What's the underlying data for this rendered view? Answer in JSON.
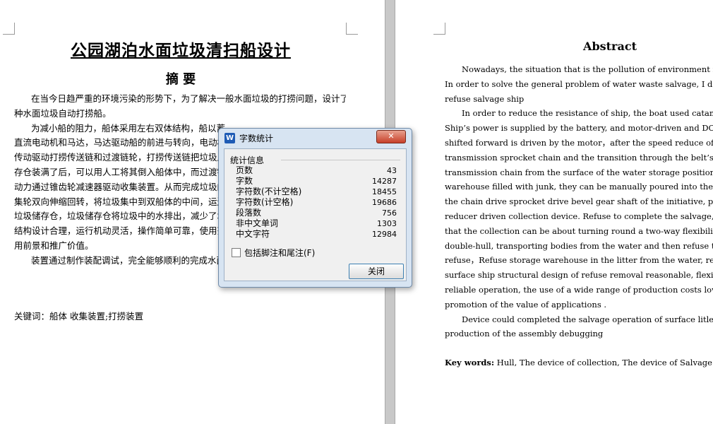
{
  "left_page": {
    "title": "公园湖泊水面垃圾清扫船设计",
    "subtitle": "摘 要",
    "body_lines": [
      {
        "text": "在当今日趋严重的环境污染的形势下，为了解决一般水面垃圾的打捞问题，设计了一",
        "indent": true
      },
      {
        "text": "种水面垃圾自动打捞船。",
        "indent": false
      },
      {
        "text": "为减小船的阻力，船体采用左右双体结构，船以蓄",
        "indent": true
      },
      {
        "text": "直流电动机和马达，马达驱动船的前进与转向，电动机",
        "indent": false
      },
      {
        "text": "传动驱动打捞传送链和过渡链轮，打捞传送链把垃圾从",
        "indent": false
      },
      {
        "text": "存仓装满了后，可以用人工将其倒入船体中，而过渡链轮",
        "indent": false
      },
      {
        "text": "动力通过锥齿轮减速器驱动收集装置。从而完成垃圾的",
        "indent": false
      },
      {
        "text": "集轮双向伸缩回转，将垃圾集中到双船体的中间，运送",
        "indent": false
      },
      {
        "text": "垃圾储存仓，垃圾储存仓将垃圾中的水排出，减少了垃",
        "indent": false
      },
      {
        "text": "结构设计合理，运行机动灵活，操作简单可靠，使用范",
        "indent": false
      },
      {
        "text": "用前景和推广价值。",
        "indent": false
      },
      {
        "text": "装置通过制作装配调试，完全能够顺利的完成水面",
        "indent": true
      }
    ],
    "keywords": "关键词：船体 收集装置;打捞装置"
  },
  "right_page": {
    "title": "Abstract",
    "body_lines": [
      {
        "text": "Nowadays, the situation that is the pollution of environment is very serious",
        "indent": true
      },
      {
        "text": "In order to solve the general problem of water waste salvage, I design a sur",
        "indent": false
      },
      {
        "text": "refuse salvage ship",
        "indent": false
      },
      {
        "text": "In order to reduce the resistance of ship, the boat used catamaran around",
        "indent": true
      },
      {
        "text": "Ship’s power is supplied by the battery, and motor-driven and    DC motor res",
        "indent": false
      },
      {
        "text": "shifted forward is driven    by the motor，after the speed reduce of Motor，W",
        "indent": false
      },
      {
        "text": "transmission sprocket chain and the transition through the belt’s driven. I",
        "indent": false
      },
      {
        "text": "transmission chain from the surface of the water storage position to refu",
        "indent": false
      },
      {
        "text": "warehouse filled with junk, they can be manually poured into the hull, and the",
        "indent": false
      },
      {
        "text": "the chain drive sprocket drive bevel gear shaft of the initiative, power throu",
        "indent": false
      },
      {
        "text": "reducer driven collection device. Refuse to complete the salvage, and its ma",
        "indent": false
      },
      {
        "text": "that the collection can be about turning round a two-way flexibility, the litter",
        "indent": false
      },
      {
        "text": "double-hull, transporting bodies from the water and then refuse to double-hull",
        "indent": false
      },
      {
        "text": "refuse，Refuse storage warehouse in the litter from the water, reducing waste w",
        "indent": false
      },
      {
        "text": "surface ship structural design of refuse removal reasonable, flexible oper",
        "indent": false
      },
      {
        "text": "reliable operation, the use of a wide range of production costs low, has gr",
        "indent": false
      },
      {
        "text": "promotion of the value of applications .",
        "indent": false
      },
      {
        "text": "Device could completed the salvage operation of surface litler while it D",
        "indent": true
      },
      {
        "text": "production of the assembly debugging",
        "indent": false
      }
    ],
    "keywords_label": "Key words:",
    "keywords_text": " Hull, The device of collection, The device of Salvage"
  },
  "dialog": {
    "app_icon": "W",
    "title": "字数统计",
    "close_glyph": "✕",
    "group_label": "统计信息",
    "stats": [
      {
        "label": "页数",
        "value": "43"
      },
      {
        "label": "字数",
        "value": "14287"
      },
      {
        "label": "字符数(不计空格)",
        "value": "18455"
      },
      {
        "label": "字符数(计空格)",
        "value": "19686"
      },
      {
        "label": "段落数",
        "value": "756"
      },
      {
        "label": "非中文单词",
        "value": "1303"
      },
      {
        "label": "中文字符",
        "value": "12984"
      }
    ],
    "checkbox_label": "包括脚注和尾注(F)",
    "close_button_label": "关闭"
  }
}
